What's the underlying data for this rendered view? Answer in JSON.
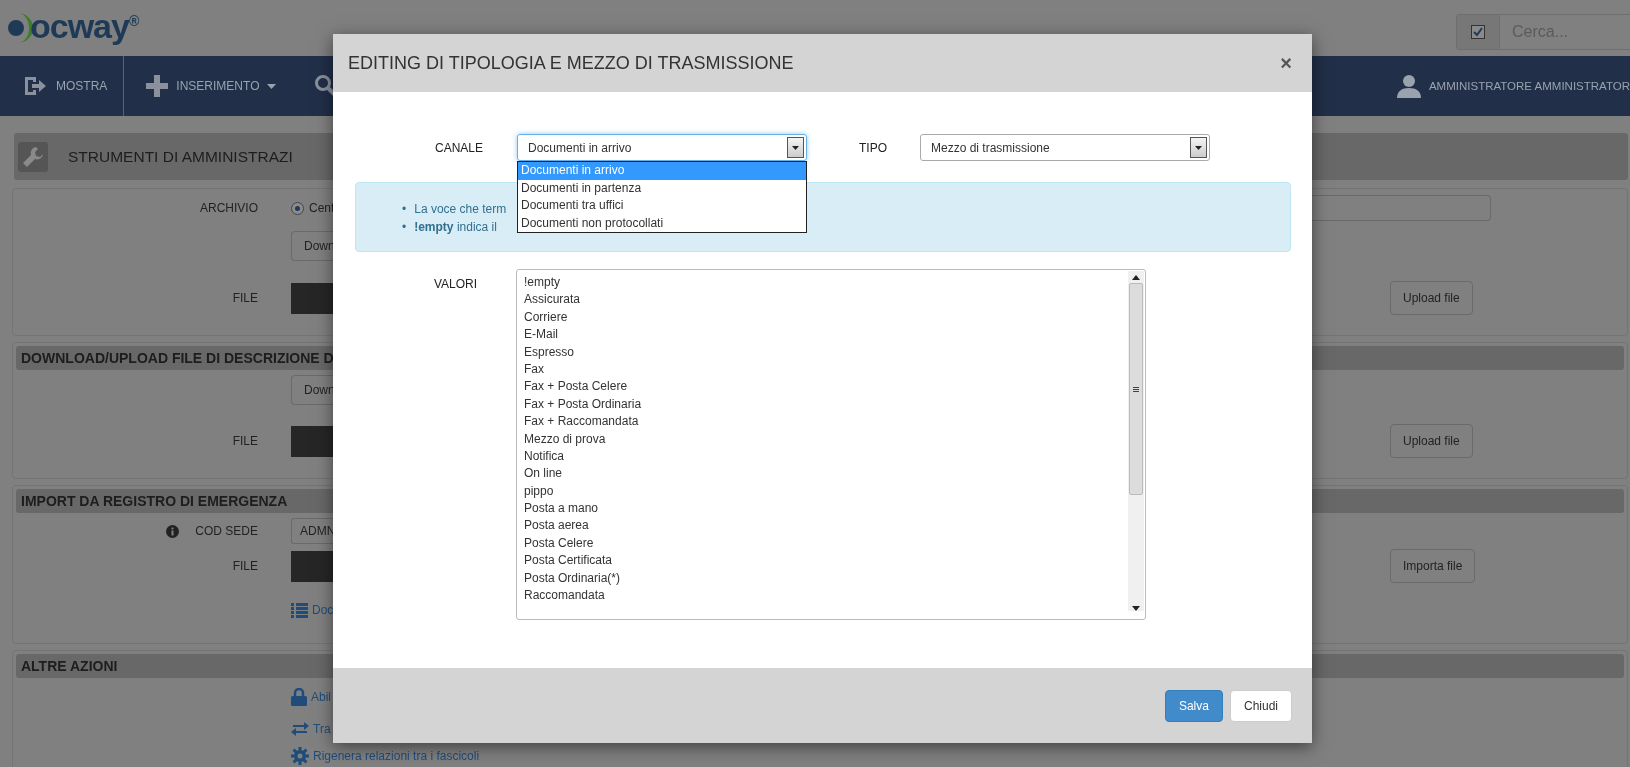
{
  "header": {
    "logo": "ocway$^{®}$",
    "search": {
      "checked": true,
      "placeholder": "Cerca..."
    }
  },
  "nav": {
    "items": [
      {
        "label": "MOSTRA",
        "has_menu": false
      },
      {
        "label": "INSERIMENTO",
        "has_menu": true
      },
      {
        "has_menu": false
      }
    ],
    "user": "AMMINISTRATORE AMMINISTRATOR"
  },
  "page_title": "STRUMENTI DI AMMINISTRAZI",
  "sections": [
    {
      "rows": [
        {
          "label": "ARCHIVIO",
          "control": {
            "kind": "radio",
            "text": "Cent",
            "selected": true
          },
          "right": {
            "kind": "field"
          }
        },
        {
          "control": {
            "kind": "button",
            "text": "Down"
          }
        },
        {
          "label": "FILE",
          "control": {
            "kind": "file"
          },
          "right": {
            "kind": "button",
            "text": "Upload file"
          }
        }
      ]
    },
    {
      "heading": "DOWNLOAD/UPLOAD FILE DI DESCRIZIONE D",
      "rows": [
        {
          "control": {
            "kind": "button",
            "text": "Down"
          }
        },
        {
          "label": "FILE",
          "control": {
            "kind": "file"
          },
          "right": {
            "kind": "button",
            "text": "Upload file"
          }
        }
      ]
    },
    {
      "heading": "IMPORT DA REGISTRO DI EMERGENZA",
      "rows": [
        {
          "label": "COD SEDE",
          "info": true,
          "control": {
            "kind": "field",
            "text": "ADMN"
          }
        },
        {
          "label": "FILE",
          "control": {
            "kind": "file"
          },
          "right": {
            "kind": "button",
            "text": "Importa file"
          }
        },
        {
          "control": {
            "kind": "link",
            "text": "Doc"
          }
        }
      ]
    },
    {
      "heading": "ALTRE AZIONI",
      "rows": [
        {
          "control": {
            "kind": "link",
            "text": "Abil"
          }
        },
        {
          "control": {
            "kind": "link",
            "text": "Tra"
          }
        },
        {
          "control": {
            "kind": "link",
            "text": "Rigenera relazioni tra i fascicoli"
          }
        }
      ]
    }
  ],
  "modal": {
    "title": "EDITING DI TIPOLOGIA E MEZZO DI TRASMISSIONE",
    "close": "×",
    "canale": {
      "label": "CANALE",
      "value": "Documenti in arrivo",
      "focused": true,
      "open": true,
      "options": [
        {
          "label": "Documenti in arrivo",
          "selected": true
        },
        {
          "label": "Documenti in partenza",
          "selected": false
        },
        {
          "label": "Documenti tra uffici",
          "selected": false
        },
        {
          "label": "Documenti non protocollati",
          "selected": false
        }
      ]
    },
    "tipo": {
      "label": "TIPO",
      "value": "Mezzo di trasmissione",
      "focused": false
    },
    "info": [
      {
        "bullet": "•",
        "text": "La voce che term"
      },
      {
        "bullet": "•",
        "text": "**!empty** indica il"
      }
    ],
    "valori": {
      "label": "VALORI",
      "items": [
        {
          "label": "!empty",
          "selected": false
        },
        {
          "label": "Assicurata",
          "selected": false
        },
        {
          "label": "Corriere",
          "selected": false
        },
        {
          "label": "E-Mail",
          "selected": false
        },
        {
          "label": "Espresso",
          "selected": false
        },
        {
          "label": "Fax",
          "selected": false
        },
        {
          "label": "Fax + Posta Celere",
          "selected": false
        },
        {
          "label": "Fax + Posta Ordinaria",
          "selected": false
        },
        {
          "label": "Fax + Raccomandata",
          "selected": false
        },
        {
          "label": "Mezzo di prova",
          "selected": false
        },
        {
          "label": "Notifica",
          "selected": false
        },
        {
          "label": "On line",
          "selected": false
        },
        {
          "label": "pippo",
          "selected": false
        },
        {
          "label": "Posta a mano",
          "selected": false
        },
        {
          "label": "Posta aerea",
          "selected": false
        },
        {
          "label": "Posta Celere",
          "selected": false
        },
        {
          "label": "Posta Certificata",
          "selected": false
        },
        {
          "label": "Posta Ordinaria(*)",
          "selected": false
        },
        {
          "label": "Raccomandata",
          "selected": false
        }
      ]
    },
    "buttons": [
      {
        "label": "Salva",
        "kind": "primary"
      },
      {
        "label": "Chiudi",
        "kind": "default"
      }
    ]
  }
}
